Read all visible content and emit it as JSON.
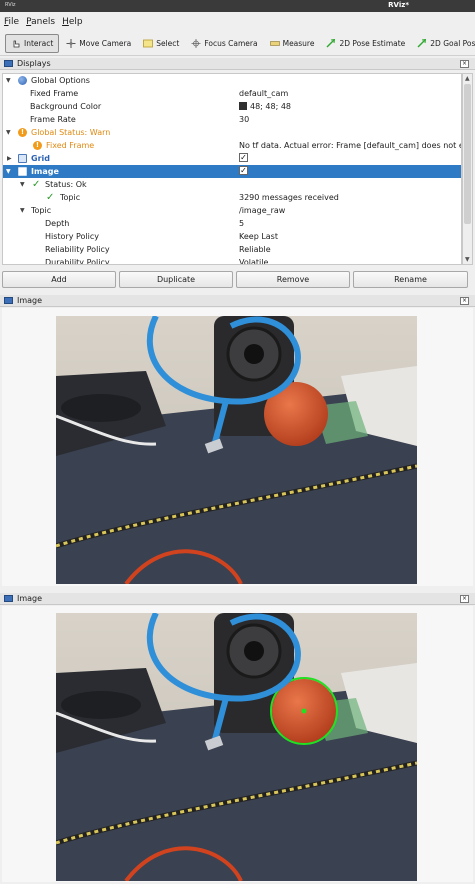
{
  "window": {
    "app_label": "RViz",
    "title": "RViz*"
  },
  "menu": [
    "File",
    "Panels",
    "Help"
  ],
  "toolbar": [
    {
      "label": "Interact",
      "icon": "interact-icon",
      "active": true
    },
    {
      "label": "Move Camera",
      "icon": "move-camera-icon"
    },
    {
      "label": "Select",
      "icon": "select-icon"
    },
    {
      "label": "Focus Camera",
      "icon": "focus-camera-icon"
    },
    {
      "label": "Measure",
      "icon": "measure-icon"
    },
    {
      "label": "2D Pose Estimate",
      "icon": "pose-estimate-icon"
    },
    {
      "label": "2D Goal Pose",
      "icon": "goal-pose-icon"
    }
  ],
  "displays_panel": {
    "title": "Displays",
    "tree": [
      {
        "label": "Global Options",
        "value": ""
      },
      {
        "label": "Fixed Frame",
        "value": "default_cam"
      },
      {
        "label": "Background Color",
        "value": "48; 48; 48"
      },
      {
        "label": "Frame Rate",
        "value": "30"
      },
      {
        "label": "Global Status: Warn",
        "value": ""
      },
      {
        "label": "Fixed Frame",
        "value": "No tf data.  Actual error: Frame [default_cam] does not exist"
      },
      {
        "label": "Grid",
        "value": ""
      },
      {
        "label": "Image",
        "value": ""
      },
      {
        "label": "Status: Ok",
        "value": ""
      },
      {
        "label": "Topic",
        "value": "3290 messages received"
      },
      {
        "label": "Topic",
        "value": "/image_raw"
      },
      {
        "label": "Depth",
        "value": "5"
      },
      {
        "label": "History Policy",
        "value": "Keep Last"
      },
      {
        "label": "Reliability Policy",
        "value": "Reliable"
      },
      {
        "label": "Durability Policy",
        "value": "Volatile"
      }
    ],
    "buttons": [
      "Add",
      "Duplicate",
      "Remove",
      "Rename"
    ]
  },
  "image_panels": [
    {
      "title": "Image",
      "detection_overlay": false
    },
    {
      "title": "Image",
      "detection_overlay": true
    }
  ],
  "colors": {
    "selection": "#2f7ac4",
    "warning": "#e08a12",
    "ok": "#2e9a2e",
    "ball": "#d9562f",
    "detection_circle": "#22e022",
    "cable": "#2f8fd8"
  }
}
